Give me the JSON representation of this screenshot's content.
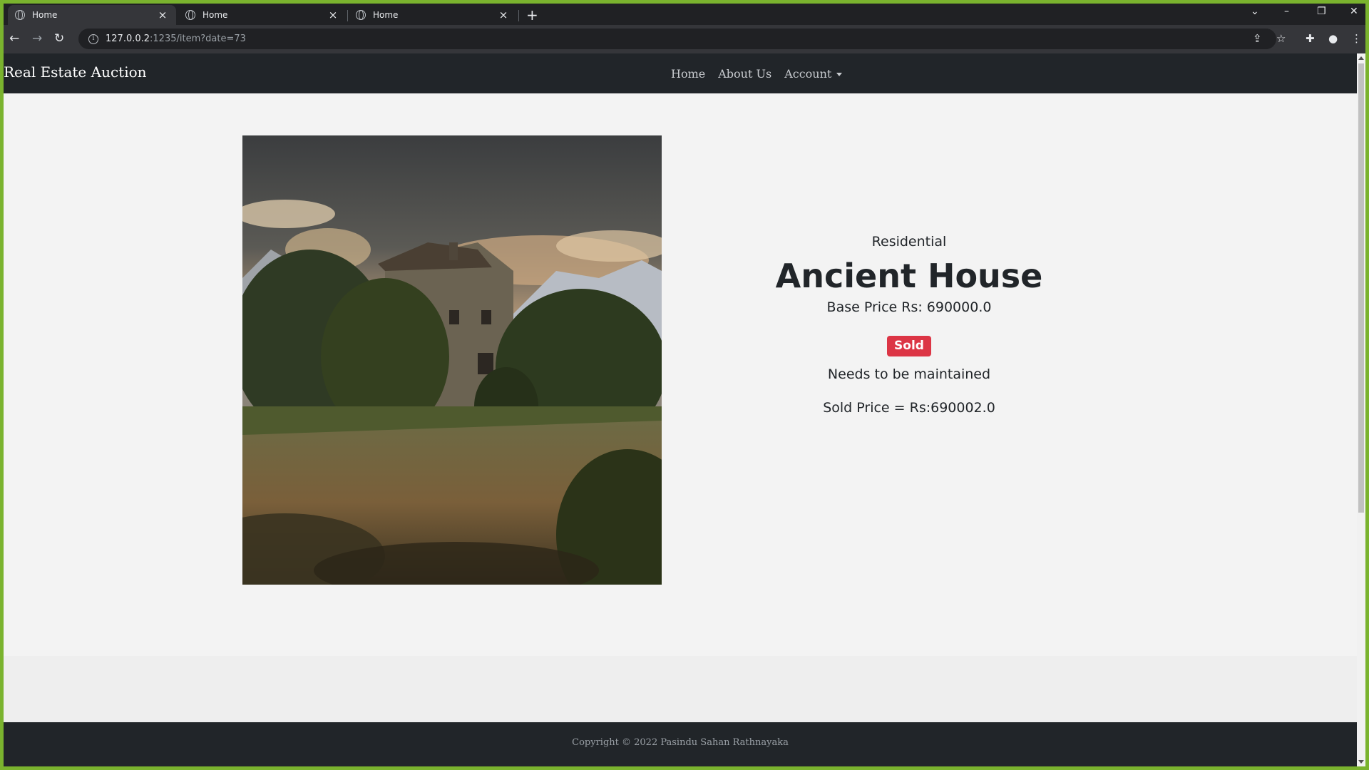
{
  "browser": {
    "tabs": [
      {
        "title": "Home",
        "active": true
      },
      {
        "title": "Home",
        "active": false
      },
      {
        "title": "Home",
        "active": false
      }
    ],
    "url_host": "127.0.0.2",
    "url_path": ":1235/item?date=73"
  },
  "site": {
    "brand": "Real Estate Auction",
    "nav": {
      "home": "Home",
      "about": "About Us",
      "account": "Account"
    }
  },
  "item": {
    "category": "Residential",
    "title": "Ancient House",
    "base_price": "Base Price Rs: 690000.0",
    "status_badge": "Sold",
    "description": "Needs to be maintained",
    "sold_price": "Sold Price = Rs:690002.0"
  },
  "footer": {
    "copyright": "Copyright © 2022 Pasindu Sahan Rathnayaka"
  },
  "colors": {
    "navbar_bg": "#212529",
    "badge_sold": "#dc3545",
    "page_bg": "#f3f3f3"
  }
}
